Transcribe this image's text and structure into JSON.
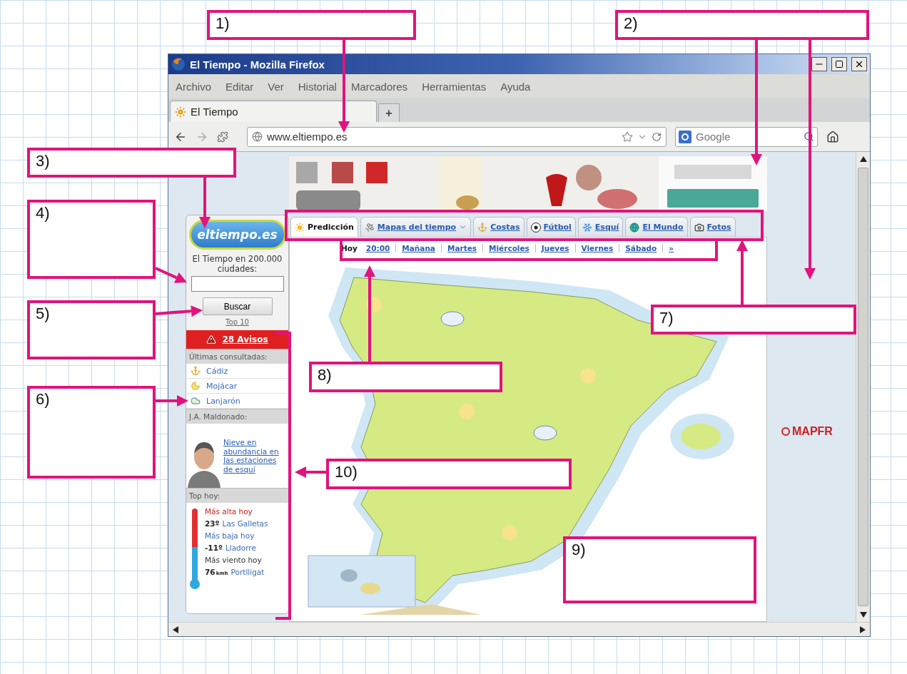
{
  "worksheet": {
    "annotations": [
      {
        "label": "1)"
      },
      {
        "label": "2)"
      },
      {
        "label": "3)"
      },
      {
        "label": "4)"
      },
      {
        "label": "5)"
      },
      {
        "label": "6)"
      },
      {
        "label": "7)"
      },
      {
        "label": "8)"
      },
      {
        "label": "9)"
      },
      {
        "label": "10)"
      }
    ]
  },
  "window": {
    "title": "El Tiempo - Mozilla Firefox"
  },
  "menu": [
    "Archivo",
    "Editar",
    "Ver",
    "Historial",
    "Marcadores",
    "Herramientas",
    "Ayuda"
  ],
  "browser_tabs": [
    {
      "label": "El Tiempo",
      "selected": true
    }
  ],
  "new_tab": "+",
  "address_bar": {
    "value": "www.eltiempo.es"
  },
  "search": {
    "placeholder": "Google"
  },
  "sidebar": {
    "logo": "eltiempo.es",
    "prompt": "El Tiempo en 200.000 ciudades:",
    "search_button": "Buscar",
    "top_link": "Top 10",
    "alerts": "28 Avisos",
    "recent_header": "Últimas consultadas:",
    "recent": [
      {
        "label": "Cádiz",
        "kind": "anchor"
      },
      {
        "label": "Mojácar",
        "kind": "moon"
      },
      {
        "label": "Lanjarón",
        "kind": "cloud"
      }
    ],
    "columnist_header": "J.A. Maldonado:",
    "columnist_link": "Nieve en abundancia en las estaciones de esquí",
    "top_header": "Top hoy:",
    "top": [
      {
        "kind": "high",
        "title": "Más alta hoy",
        "value": "23º",
        "place": "Las Galletas"
      },
      {
        "kind": "low",
        "title": "Más baja hoy",
        "value": "-11º",
        "place": "Lladorre"
      },
      {
        "kind": "wind",
        "title": "Más viento hoy",
        "value": "76",
        "unit": "kmh",
        "place": "Portlligat"
      }
    ]
  },
  "site_tabs": [
    {
      "label": "Predicción",
      "kind": "sun",
      "selected": true,
      "has_menu": false
    },
    {
      "label": "Mapas del tiempo",
      "kind": "satellite",
      "selected": false,
      "has_menu": true
    },
    {
      "label": "Costas",
      "kind": "anchor",
      "selected": false,
      "has_menu": false
    },
    {
      "label": "Fútbol",
      "kind": "ball",
      "selected": false,
      "has_menu": false
    },
    {
      "label": "Esquí",
      "kind": "snowflake",
      "selected": false,
      "has_menu": false
    },
    {
      "label": "El Mundo",
      "kind": "globe",
      "selected": false,
      "has_menu": false
    },
    {
      "label": "Fotos",
      "kind": "camera",
      "selected": false,
      "has_menu": false
    }
  ],
  "day_nav": {
    "today": "Hoy",
    "time": "20:00",
    "days": [
      "Mañana",
      "Martes",
      "Miércoles",
      "Jueves",
      "Viernes",
      "Sábado"
    ],
    "more": "»"
  },
  "ad": {
    "brand": "MAPFR"
  }
}
